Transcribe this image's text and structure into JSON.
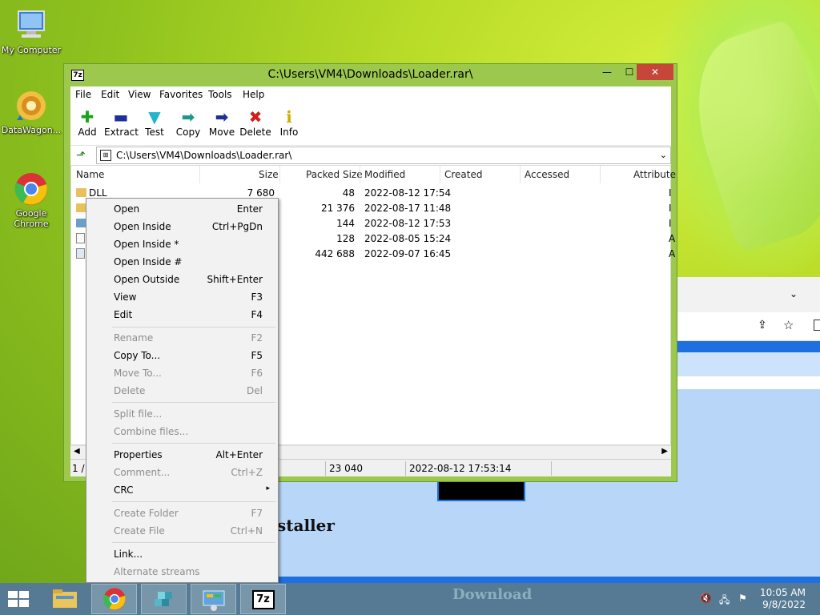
{
  "desktop": {
    "icons": [
      {
        "label": "My Computer",
        "icon": "computer-icon"
      },
      {
        "label": "DataWagon...",
        "icon": "datawagon-icon"
      },
      {
        "label": "Google Chrome",
        "icon": "chrome-icon"
      }
    ]
  },
  "background_page": {
    "heading_fragment": "staller",
    "taskbar_overlay_text": "Download"
  },
  "window": {
    "app_badge": "7z",
    "title": "C:\\Users\\VM4\\Downloads\\Loader.rar\\",
    "controls": {
      "minimize": "—",
      "maximize": "☐",
      "close": "✕"
    },
    "menu": [
      "File",
      "Edit",
      "View",
      "Favorites",
      "Tools",
      "Help"
    ],
    "toolbar": [
      {
        "label": "Add",
        "icon": "add-icon",
        "glyph": "✚",
        "color": "#19a319"
      },
      {
        "label": "Extract",
        "icon": "extract-icon",
        "glyph": "▬",
        "color": "#1d2f9a"
      },
      {
        "label": "Test",
        "icon": "test-icon",
        "glyph": "▼",
        "color": "#21b6c9"
      },
      {
        "label": "Copy",
        "icon": "copy-icon",
        "glyph": "➡",
        "color": "#1a9a8a"
      },
      {
        "label": "Move",
        "icon": "move-icon",
        "glyph": "➡",
        "color": "#1d2f9a"
      },
      {
        "label": "Delete",
        "icon": "delete-icon",
        "glyph": "✖",
        "color": "#d21d1d"
      },
      {
        "label": "Info",
        "icon": "info-icon",
        "glyph": "ℹ",
        "color": "#c9b000"
      }
    ],
    "address": "C:\\Users\\VM4\\Downloads\\Loader.rar\\",
    "columns": [
      "Name",
      "Size",
      "Packed Size",
      "Modified",
      "Created",
      "Accessed",
      "Attribute"
    ],
    "rows": [
      {
        "name": "DLL",
        "type": "folder",
        "size": "7 680",
        "packed": "48",
        "modified": "2022-08-12 17:54",
        "attr": "I"
      },
      {
        "name": "",
        "type": "folder",
        "size": "",
        "packed": "21 376",
        "modified": "2022-08-17 11:48",
        "attr": "I"
      },
      {
        "name": "",
        "type": "folder",
        "size": "",
        "packed": "144",
        "modified": "2022-08-12 17:53",
        "attr": "I"
      },
      {
        "name": "",
        "type": "file",
        "size": "",
        "packed": "128",
        "modified": "2022-08-05 15:24",
        "attr": "A"
      },
      {
        "name": "",
        "type": "exe",
        "size": "",
        "packed": "442 688",
        "modified": "2022-09-07 16:45",
        "attr": "A"
      }
    ],
    "status": {
      "selection": "1 / 5",
      "size": "23 040",
      "modified": "2022-08-12 17:53:14"
    }
  },
  "context_menu": {
    "groups": [
      [
        {
          "label": "Open",
          "shortcut": "Enter",
          "enabled": true
        },
        {
          "label": "Open Inside",
          "shortcut": "Ctrl+PgDn",
          "enabled": true
        },
        {
          "label": "Open Inside *",
          "shortcut": "",
          "enabled": true
        },
        {
          "label": "Open Inside #",
          "shortcut": "",
          "enabled": true
        },
        {
          "label": "Open Outside",
          "shortcut": "Shift+Enter",
          "enabled": true
        },
        {
          "label": "View",
          "shortcut": "F3",
          "enabled": true
        },
        {
          "label": "Edit",
          "shortcut": "F4",
          "enabled": true
        }
      ],
      [
        {
          "label": "Rename",
          "shortcut": "F2",
          "enabled": false
        },
        {
          "label": "Copy To...",
          "shortcut": "F5",
          "enabled": true
        },
        {
          "label": "Move To...",
          "shortcut": "F6",
          "enabled": false
        },
        {
          "label": "Delete",
          "shortcut": "Del",
          "enabled": false
        }
      ],
      [
        {
          "label": "Split file...",
          "shortcut": "",
          "enabled": false
        },
        {
          "label": "Combine files...",
          "shortcut": "",
          "enabled": false
        }
      ],
      [
        {
          "label": "Properties",
          "shortcut": "Alt+Enter",
          "enabled": true
        },
        {
          "label": "Comment...",
          "shortcut": "Ctrl+Z",
          "enabled": false
        },
        {
          "label": "CRC",
          "shortcut": "",
          "enabled": true,
          "submenu": true
        }
      ],
      [
        {
          "label": "Create Folder",
          "shortcut": "F7",
          "enabled": false
        },
        {
          "label": "Create File",
          "shortcut": "Ctrl+N",
          "enabled": false
        }
      ],
      [
        {
          "label": "Link...",
          "shortcut": "",
          "enabled": true
        },
        {
          "label": "Alternate streams",
          "shortcut": "",
          "enabled": false
        }
      ]
    ]
  },
  "taskbar": {
    "apps": [
      {
        "name": "file-explorer",
        "icon": "folder-icon"
      },
      {
        "name": "chrome",
        "icon": "chrome-icon"
      },
      {
        "name": "app3",
        "icon": "cubes-icon"
      },
      {
        "name": "control-panel",
        "icon": "control-panel-icon"
      },
      {
        "name": "7zip",
        "icon": "7zip-icon",
        "badge": "7z"
      }
    ],
    "time": "10:05 AM",
    "date": "9/8/2022"
  }
}
